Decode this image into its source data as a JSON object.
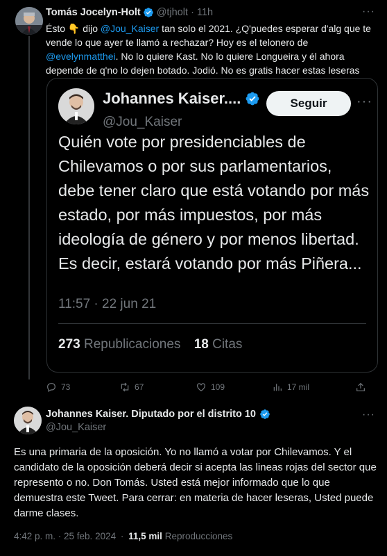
{
  "tweet1": {
    "author_name": "Tomás Jocelyn-Holt",
    "handle": "@tjholt",
    "time": "11h",
    "text_parts": {
      "p1": "Ésto ",
      "emoji": "👇",
      "p2": " dijo ",
      "mention1": "@Jou_Kaiser",
      "p3": " tan solo el 2021. ¿Q'puedes esperar d'alg que te vende lo que ayer te llamó a rechazar? Hoy es el telonero de ",
      "mention2": "@evelynmatthei",
      "p4": ". No lo quiere Kast. No lo quiere Longueira y él ahora depende de q'no lo dejen botado. Jodió. No es gratis hacer estas leseras"
    },
    "actions": {
      "replies": "73",
      "retweets": "67",
      "likes": "109",
      "views": "17 mil"
    }
  },
  "quoted": {
    "author_name": "Johannes Kaiser....",
    "handle": "@Jou_Kaiser",
    "follow_label": "Seguir",
    "text": "Quién vote por presidenciables de Chilevamos o por sus parlamentarios, debe tener claro que está votando por más estado, por más impuestos, por más ideología de género y por menos libertad. Es decir, estará votando por más Piñera...",
    "time": "11:57 · 22 jun 21",
    "retweets_count": "273",
    "retweets_label": "Republicaciones",
    "quotes_count": "18",
    "quotes_label": "Citas"
  },
  "tweet2": {
    "author_name": "Johannes Kaiser. Diputado por el distrito 10",
    "handle": "@Jou_Kaiser",
    "text": "Es una primaria de la oposición. Yo no llamó a votar por Chilevamos. Y el candidato de la oposición deberá decir si acepta las lineas rojas del sector que represento o no. Don Tomás. Usted está mejor informado que lo que demuestra este Tweet. Para cerrar: en materia de hacer leseras, Usted puede darme clases.",
    "timestamp": "4:42 p. m. · 25 feb. 2024",
    "views_count": "11,5 mil",
    "views_label": "Reproducciones"
  },
  "colors": {
    "background": "#000000",
    "text": "#e7e9ea",
    "muted": "#71767b",
    "accent": "#1d9bf0",
    "border": "#2f3336"
  },
  "icons": [
    "verified-badge-icon",
    "more-icon",
    "reply-icon",
    "retweet-icon",
    "like-icon",
    "views-icon",
    "share-icon"
  ]
}
